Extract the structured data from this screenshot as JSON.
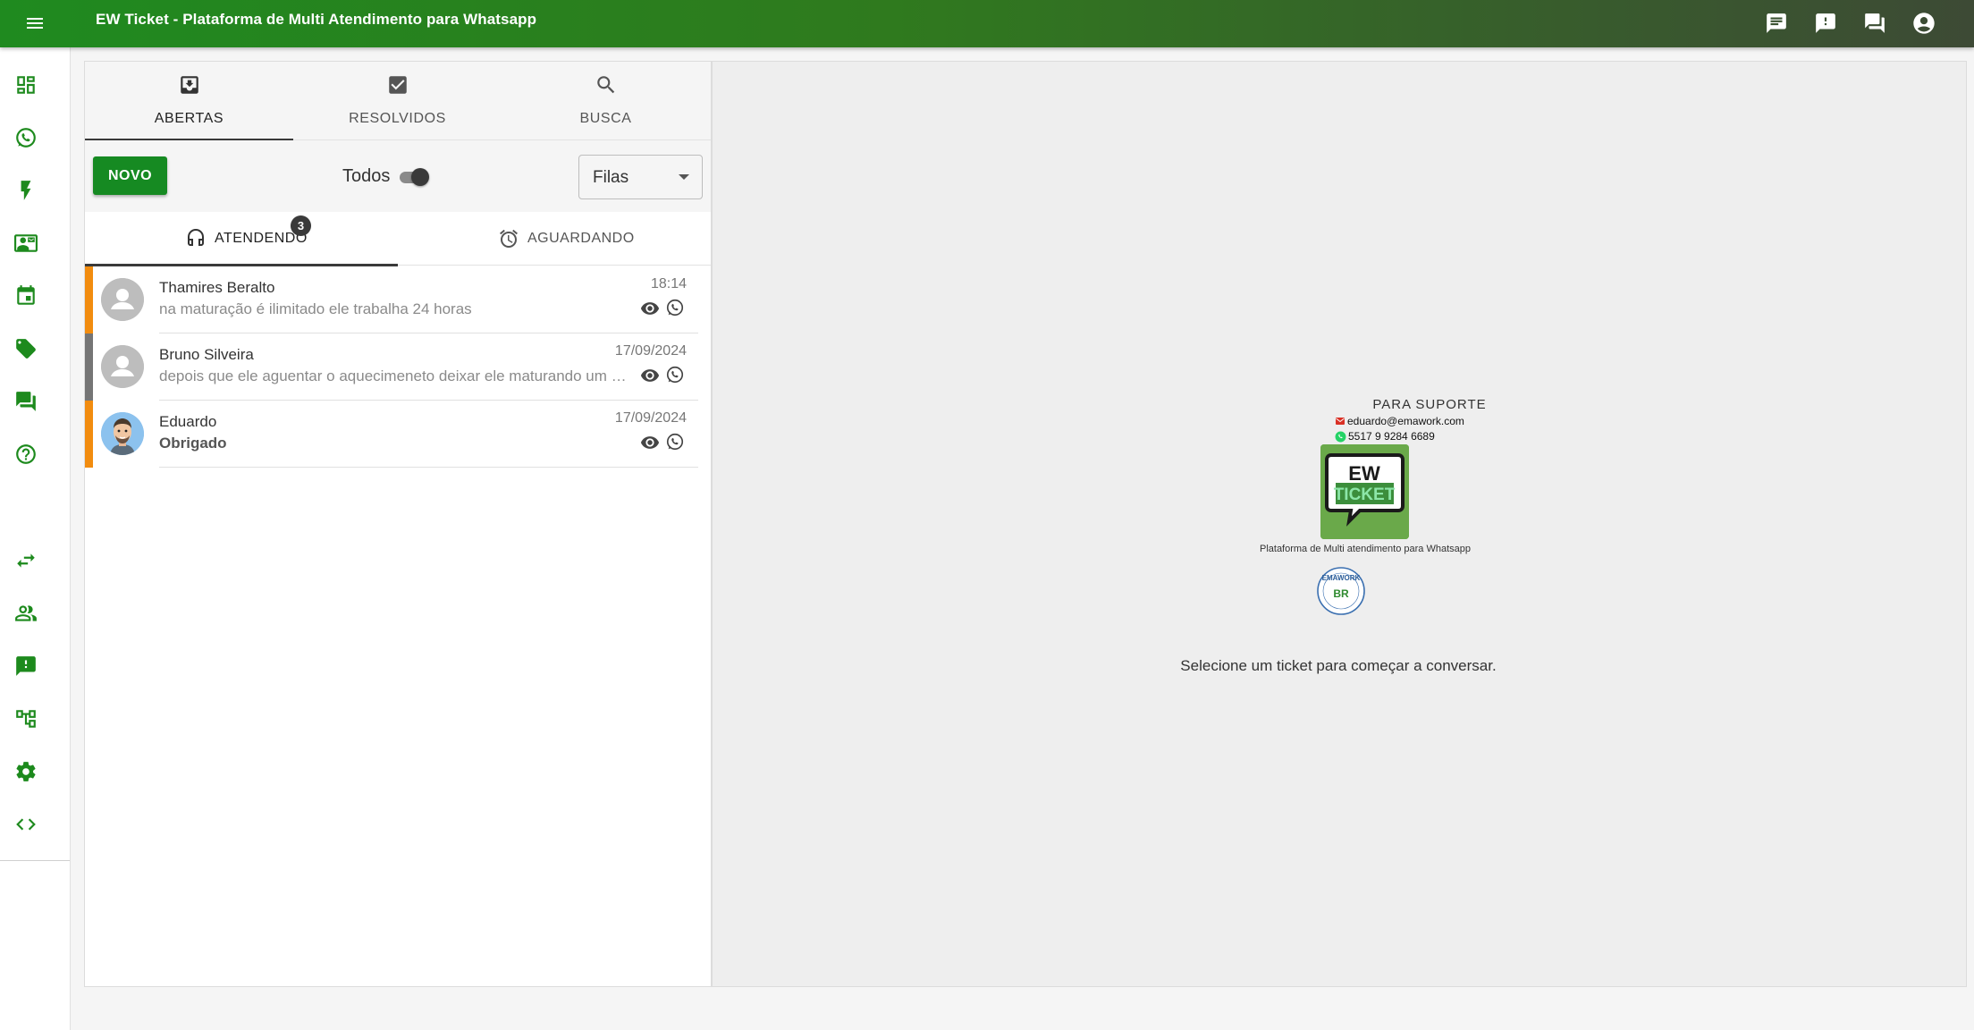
{
  "app": {
    "title": "EW Ticket - Plataforma de Multi Atendimento para Whatsapp",
    "brand_gradient": [
      "#1f8a1f",
      "#3d4a35"
    ]
  },
  "topbar": {
    "icons": [
      "menu-icon",
      "chat-icon",
      "feedback-icon",
      "forum-icon",
      "account-circle-icon"
    ]
  },
  "sidebar": {
    "items": [
      {
        "icon": "dashboard-icon"
      },
      {
        "icon": "whatsapp-icon"
      },
      {
        "icon": "flash-icon"
      },
      {
        "icon": "contacts-icon"
      },
      {
        "icon": "calendar-icon"
      },
      {
        "icon": "tag-icon"
      },
      {
        "icon": "forum-icon"
      },
      {
        "icon": "help-icon"
      },
      {
        "icon": "swap-icon"
      },
      {
        "icon": "people-icon"
      },
      {
        "icon": "announcement-icon"
      },
      {
        "icon": "queue-tree-icon"
      },
      {
        "icon": "settings-icon"
      },
      {
        "icon": "code-icon"
      }
    ]
  },
  "tickets_panel": {
    "tabs": [
      {
        "label": "ABERTAS",
        "icon": "inbox-icon",
        "active": true
      },
      {
        "label": "RESOLVIDOS",
        "icon": "check-box-icon",
        "active": false
      },
      {
        "label": "BUSCA",
        "icon": "search-icon",
        "active": false
      }
    ],
    "new_button": "NOVO",
    "todos_label": "Todos",
    "todos_toggle": true,
    "queue_select": "Filas",
    "subtabs": [
      {
        "label": "ATENDENDO",
        "icon": "headset-icon",
        "badge": "3",
        "active": true
      },
      {
        "label": "AGUARDANDO",
        "icon": "alarm-icon",
        "active": false
      }
    ],
    "tickets": [
      {
        "name": "Thamires Beralto",
        "message": "na maturação é ilimitado ele trabalha 24 horas",
        "time": "18:14",
        "queue_color": "#f28c0f",
        "avatar": "default"
      },
      {
        "name": "Bruno Silveira",
        "message": "depois que ele aguentar o aquecimeneto deixar ele maturando um bo...",
        "time": "17/09/2024",
        "queue_color": "#757575",
        "avatar": "default"
      },
      {
        "name": "Eduardo",
        "message": "Obrigado",
        "time": "17/09/2024",
        "queue_color": "#f28c0f",
        "avatar": "cartoon"
      }
    ]
  },
  "welcome": {
    "support_title": "PARA SUPORTE",
    "email": "eduardo@emawork.com",
    "phone": "5517 9 9284 6689",
    "logo_top": "EW",
    "logo_bottom": "TICKET",
    "tagline": "Plataforma de Multi atendimento para Whatsapp",
    "seal_text": "EMAWORK",
    "seal_mark": "BR",
    "message": "Selecione um ticket para começar a conversar."
  }
}
